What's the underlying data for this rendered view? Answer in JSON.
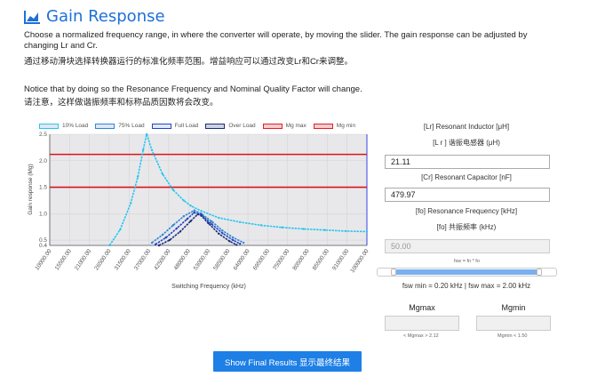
{
  "title": "Gain Response",
  "paragraph1": "Choose a normalized frequency range, in where the converter will operate, by moving the slider. The gain response can be adjusted by changing Lr and Cr.",
  "paragraph2": "通过移动滑块选择转换器运行的标准化频率范围。增益响应可以通过改变Lr和Cr来调整。",
  "paragraph3": "Notice that by doing so the Resonance Frequency and Nominal Quality Factor will change.",
  "paragraph4": "请注意，这样做谐振频率和标称品质因数将会改变。",
  "legend": [
    {
      "label": "10% Load",
      "color": "#29c5ef"
    },
    {
      "label": "75% Load",
      "color": "#2d86d8"
    },
    {
      "label": "Full Load",
      "color": "#2244c8"
    },
    {
      "label": "Over Load",
      "color": "#1a2f78"
    },
    {
      "label": "Mg max",
      "color": "#e0202a"
    },
    {
      "label": "Mg min",
      "color": "#e0202a"
    }
  ],
  "chart_data": {
    "type": "line",
    "ylabel": "Gain response (Mg)",
    "xlabel": "Switching Frequency (kHz)",
    "ylim": [
      0.4,
      2.5
    ],
    "yticks": [
      2.5,
      2.0,
      1.5,
      1.0,
      0.5,
      0.4
    ],
    "xticks": [
      "10000.00",
      "15500.00",
      "21000.00",
      "26500.00",
      "31500.00",
      "37000.00",
      "42500.00",
      "48000.00",
      "53000.00",
      "58500.00",
      "64000.00",
      "69500.00",
      "75000.00",
      "80500.00",
      "85500.00",
      "91000.00",
      "100000.00"
    ],
    "mg_max": 2.12,
    "mg_min": 1.5,
    "series": [
      {
        "name": "10% Load",
        "x": [
          27000,
          30000,
          33000,
          35000,
          36500,
          37500,
          39000,
          42000,
          45000,
          48000,
          50000,
          53000,
          58000,
          64000,
          70000,
          76000,
          82000,
          88000,
          94000,
          100000
        ],
        "y": [
          0.4,
          0.7,
          1.2,
          1.7,
          2.2,
          2.5,
          2.2,
          1.75,
          1.45,
          1.25,
          1.15,
          1.05,
          0.92,
          0.84,
          0.78,
          0.74,
          0.71,
          0.69,
          0.67,
          0.66
        ]
      },
      {
        "name": "75% Load",
        "x": [
          39000,
          42000,
          45000,
          48000,
          51000,
          53000,
          56000,
          59000,
          62000,
          65000
        ],
        "y": [
          0.45,
          0.6,
          0.78,
          0.95,
          1.06,
          1.0,
          0.85,
          0.68,
          0.55,
          0.45
        ]
      },
      {
        "name": "Full Load",
        "x": [
          40000,
          43000,
          46000,
          49000,
          51000,
          53000,
          56000,
          59000,
          62000,
          64000
        ],
        "y": [
          0.42,
          0.55,
          0.72,
          0.9,
          1.02,
          0.98,
          0.8,
          0.63,
          0.5,
          0.43
        ]
      },
      {
        "name": "Over Load",
        "x": [
          41000,
          44000,
          47000,
          50000,
          52000,
          53000,
          55000,
          58000,
          61000,
          63000
        ],
        "y": [
          0.4,
          0.5,
          0.66,
          0.86,
          0.99,
          0.96,
          0.82,
          0.62,
          0.48,
          0.41
        ]
      }
    ]
  },
  "right_panel": {
    "lr_label": "[Lr] Resonant Inductor [μH]",
    "lr_label_cn": "[L r ] 谐振电感器 (μH)",
    "lr_value": "21.11",
    "cr_label": "[Cr] Resonant Capacitor [nF]",
    "cr_value": "479.97",
    "fo_label": "[fo] Resonance Frequency [kHz]",
    "fo_label_cn": "[fo] 共振频率 (kHz)",
    "fo_value": "50.00",
    "formula": "fsw = fn * fo",
    "range_text": "fsw min = 0.20 kHz | fsw max = 2.00 kHz",
    "mg_max_label": "Mgmax",
    "mg_min_label": "Mgmin",
    "mg_max_hint": "< Mgmax > 2.12",
    "mg_min_hint": "Mgmin < 1.50"
  },
  "button_label": "Show Final Results  显示最终结果"
}
